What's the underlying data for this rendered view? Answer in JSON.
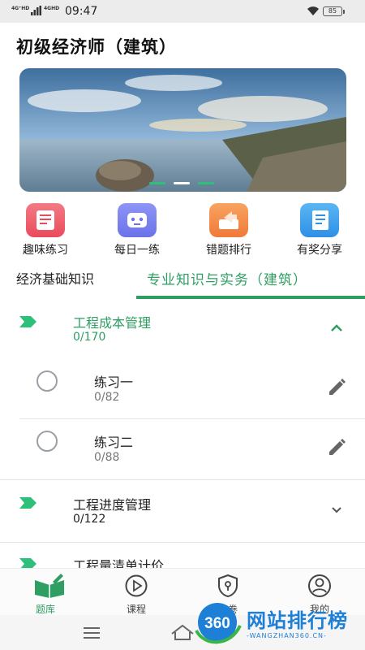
{
  "status": {
    "time": "09:47",
    "net1": "4G⁺HD",
    "net2": "4GHD",
    "battery": "85"
  },
  "app": {
    "title": "初级经济师（建筑）"
  },
  "shortcuts": [
    {
      "label": "趣味练习",
      "icon": "quiz-icon",
      "color": "#f0626d"
    },
    {
      "label": "每日一练",
      "icon": "robot-icon",
      "color": "#7b83f2"
    },
    {
      "label": "错题排行",
      "icon": "ranking-icon",
      "color": "#f5904a"
    },
    {
      "label": "有奖分享",
      "icon": "notebook-icon",
      "color": "#3aa3ee"
    }
  ],
  "tabs": [
    {
      "label": "经济基础知识",
      "active": false
    },
    {
      "label": "专业知识与实务（建筑）",
      "active": true
    }
  ],
  "chapters": [
    {
      "title": "工程成本管理",
      "count": "0/170",
      "expanded": true,
      "items": [
        {
          "title": "练习一",
          "count": "0/82"
        },
        {
          "title": "练习二",
          "count": "0/88"
        }
      ]
    },
    {
      "title": "工程进度管理",
      "count": "0/122",
      "expanded": false
    },
    {
      "title": "工程量清单计价",
      "expanded": false
    }
  ],
  "bottom_nav": [
    {
      "label": "题库",
      "icon": "book-icon",
      "active": true
    },
    {
      "label": "课程",
      "icon": "play-icon",
      "active": false
    },
    {
      "label": "密卷",
      "icon": "lock-shield-icon",
      "active": false
    },
    {
      "label": "我的",
      "icon": "user-icon",
      "active": false
    }
  ],
  "watermark": {
    "brand": "360",
    "text": "网站排行榜",
    "sub": "-WANGZHAN360.CN-"
  },
  "colors": {
    "accent": "#2e9e62",
    "flag": "#2ec07a"
  }
}
